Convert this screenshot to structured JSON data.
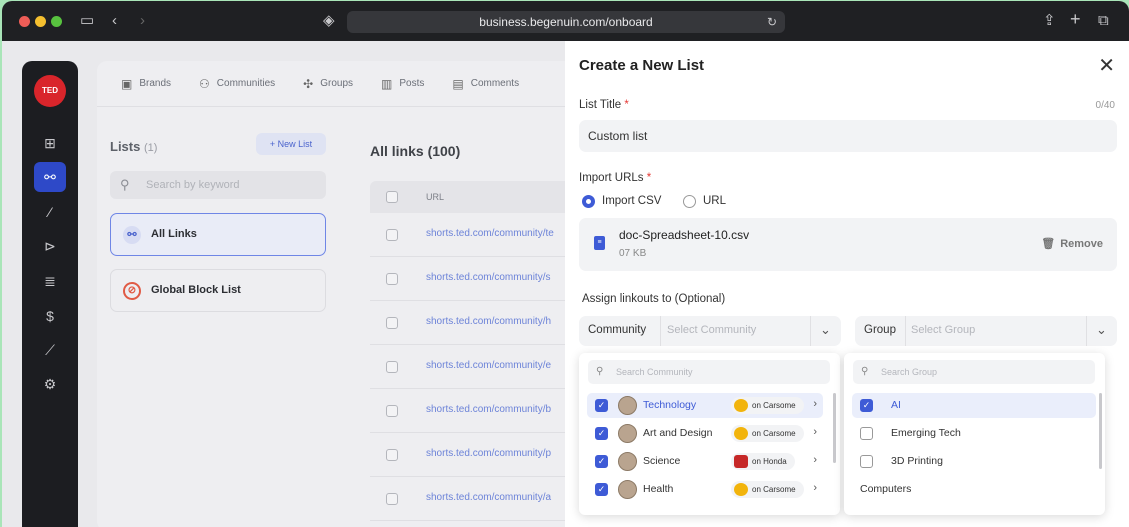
{
  "browser": {
    "url": "business.begenuin.com/onboard",
    "traffic_colors": [
      "#ee5d57",
      "#f4bf2f",
      "#58c23f"
    ]
  },
  "leftnav": {
    "logo_text": "TED",
    "items": [
      {
        "name": "grid-icon",
        "glyph": "⊞"
      },
      {
        "name": "links-icon",
        "glyph": "⚯"
      },
      {
        "name": "magic-wand-icon",
        "glyph": "⁄"
      },
      {
        "name": "video-icon",
        "glyph": "⊳"
      },
      {
        "name": "checklist-icon",
        "glyph": "≣"
      },
      {
        "name": "dollar-icon",
        "glyph": "$"
      },
      {
        "name": "analytics-icon",
        "glyph": "⟋"
      },
      {
        "name": "settings-icon",
        "glyph": "⚙"
      }
    ]
  },
  "tabs": [
    {
      "label": "Brands",
      "icon": "briefcase-icon",
      "glyph": "▣"
    },
    {
      "label": "Communities",
      "icon": "people-icon",
      "glyph": "⚇"
    },
    {
      "label": "Groups",
      "icon": "groups-icon",
      "glyph": "✣"
    },
    {
      "label": "Posts",
      "icon": "posts-icon",
      "glyph": "▥"
    },
    {
      "label": "Comments",
      "icon": "comments-icon",
      "glyph": "▤"
    }
  ],
  "lists": {
    "title": "Lists",
    "count": "(1)",
    "new_list_label": "+ New List",
    "search_placeholder": "Search by keyword",
    "items": [
      {
        "label": "All Links",
        "selected": true
      },
      {
        "label": "Global Block List",
        "selected": false
      }
    ]
  },
  "links": {
    "title": "All links (100)",
    "column_url": "URL",
    "rows": [
      "shorts.ted.com/community/te",
      "shorts.ted.com/community/s",
      "shorts.ted.com/community/h",
      "shorts.ted.com/community/e",
      "shorts.ted.com/community/b",
      "shorts.ted.com/community/p",
      "shorts.ted.com/community/a"
    ]
  },
  "panel": {
    "title": "Create a New List",
    "list_title_label": "List Title",
    "list_title_counter": "0/40",
    "list_title_value": "Custom list",
    "import_label": "Import URLs",
    "radio_csv": "Import CSV",
    "radio_url": "URL",
    "file_name": "doc-Spreadsheet-10.csv",
    "file_size": "07 KB",
    "remove_label": "Remove",
    "assign_label": "Assign linkouts to (Optional)",
    "community_label": "Community",
    "community_placeholder": "Select Community",
    "group_label": "Group",
    "group_placeholder": "Select Group"
  },
  "community_dropdown": {
    "search_placeholder": "Search Community",
    "items": [
      {
        "name": "Technology",
        "badge": "on Carsome",
        "brand": "carsome",
        "checked": true,
        "highlighted": true
      },
      {
        "name": "Art and Design",
        "badge": "on Carsome",
        "brand": "carsome",
        "checked": true,
        "highlighted": false
      },
      {
        "name": "Science",
        "badge": "on Honda",
        "brand": "honda",
        "checked": true,
        "highlighted": false
      },
      {
        "name": "Health",
        "badge": "on Carsome",
        "brand": "carsome",
        "checked": true,
        "highlighted": false
      }
    ]
  },
  "group_dropdown": {
    "search_placeholder": "Search Group",
    "items": [
      {
        "name": "AI",
        "checked": true,
        "highlighted": true
      },
      {
        "name": "Emerging Tech",
        "checked": false,
        "highlighted": false
      },
      {
        "name": "3D Printing",
        "checked": false,
        "highlighted": false
      }
    ],
    "category": "Computers"
  },
  "colors": {
    "accent": "#3e5bd6",
    "required": "#e53935",
    "ted_red": "#d9252b"
  }
}
